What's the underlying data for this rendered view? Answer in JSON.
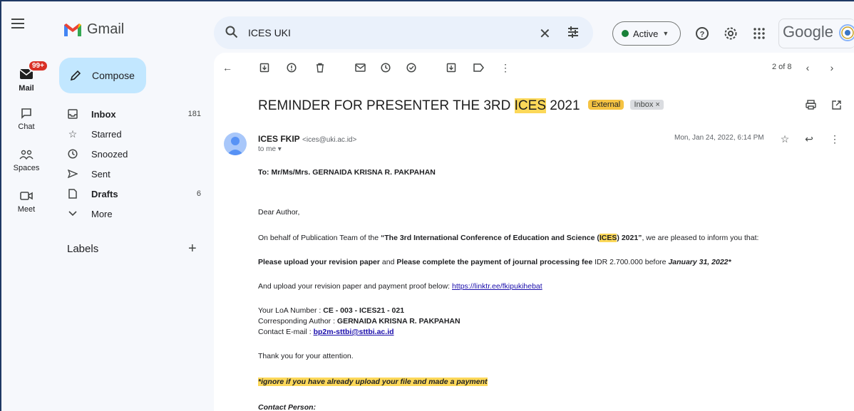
{
  "app": {
    "name": "Gmail"
  },
  "search": {
    "query": "ICES UKI"
  },
  "status": {
    "label": "Active"
  },
  "brand": {
    "google": "Google"
  },
  "rail": {
    "mail_badge": "99+",
    "items": [
      "Mail",
      "Chat",
      "Spaces",
      "Meet"
    ]
  },
  "compose": {
    "label": "Compose"
  },
  "nav": {
    "items": [
      {
        "label": "Inbox",
        "count": "181"
      },
      {
        "label": "Starred",
        "count": ""
      },
      {
        "label": "Snoozed",
        "count": ""
      },
      {
        "label": "Sent",
        "count": ""
      },
      {
        "label": "Drafts",
        "count": "6"
      },
      {
        "label": "More",
        "count": ""
      }
    ],
    "labels_heading": "Labels"
  },
  "toolbar": {
    "pager": "2 of 8"
  },
  "email": {
    "subject_pre": "REMINDER FOR PRESENTER THE 3RD ",
    "subject_hl": "ICES",
    "subject_post": " 2021",
    "tag_external": "External",
    "tag_inbox": "Inbox ×",
    "sender_name": "ICES FKIP",
    "sender_email": "<ices@uki.ac.id>",
    "to": "to me ▾",
    "date": "Mon, Jan 24, 2022, 6:14 PM",
    "to_line": "To: Mr/Ms/Mrs. GERNAIDA KRISNA R. PAKPAHAN",
    "greeting": "Dear Author,",
    "p1_a": "On behalf of Publication Team of the ",
    "p1_b": "“The 3rd International Conference of Education and Science (",
    "p1_hl": "ICES",
    "p1_c": ") 2021”",
    "p1_d": ", we are pleased to inform you that:",
    "p2_a": "Please upload your revision paper",
    "p2_b": " and ",
    "p2_c": "Please complete the payment of journal processing fee",
    "p2_d": " IDR 2.700.000 before ",
    "p2_e": "January 31, 2022*",
    "p3_a": "And upload your revision paper and payment proof below: ",
    "p3_link": "https://linktr.ee/fkipukihebat",
    "loa_label": "Your LoA Number : ",
    "loa_value": "CE - 003 - ICES21 - 021",
    "corr_label": "Corresponding Author : ",
    "corr_value": "GERNAIDA KRISNA R. PAKPAHAN",
    "contact_label": "Contact E-mail : ",
    "contact_value": "bp2m-sttbi@sttbi.ac.id",
    "thanks": "Thank you for your attention.",
    "ignore": "*ignore if you have already upload your file and made a payment",
    "contact_person": "Contact Person:"
  }
}
